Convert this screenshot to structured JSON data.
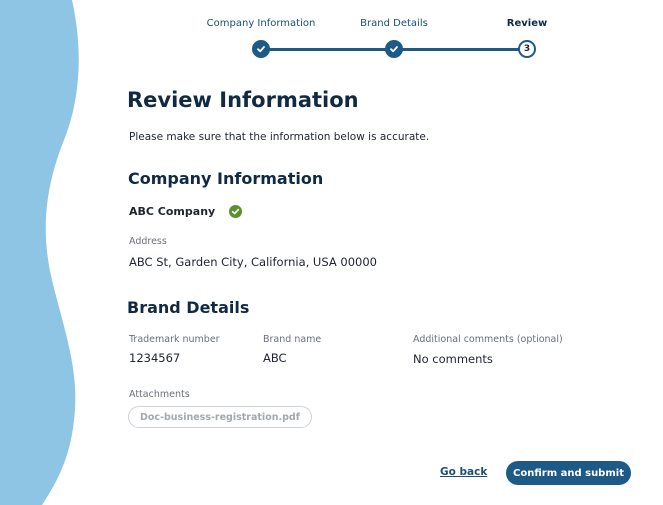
{
  "stepper": {
    "steps": [
      {
        "label": "Company Information",
        "state": "complete"
      },
      {
        "label": "Brand Details",
        "state": "complete"
      },
      {
        "label": "Review",
        "state": "current",
        "number": "3"
      }
    ]
  },
  "page": {
    "title": "Review Information",
    "intro": "Please make sure that the information below is accurate."
  },
  "company": {
    "section_title": "Company Information",
    "name": "ABC Company",
    "verified_icon": "check-circle-icon",
    "address_label": "Address",
    "address_value": "ABC St, Garden City, California, USA 00000"
  },
  "brand": {
    "section_title": "Brand Details",
    "trademark_label": "Trademark number",
    "trademark_value": "1234567",
    "brand_name_label": "Brand name",
    "brand_name_value": "ABC",
    "comments_label": "Additional comments (optional)",
    "comments_value": "No comments",
    "attachments_label": "Attachments",
    "attachment_file": "Doc-business-registration.pdf"
  },
  "actions": {
    "go_back": "Go back",
    "confirm": "Confirm and submit"
  },
  "colors": {
    "primary": "#1d5a86",
    "heading": "#112a44",
    "wave": "#8ec5e4",
    "success": "#5e8f2e"
  }
}
